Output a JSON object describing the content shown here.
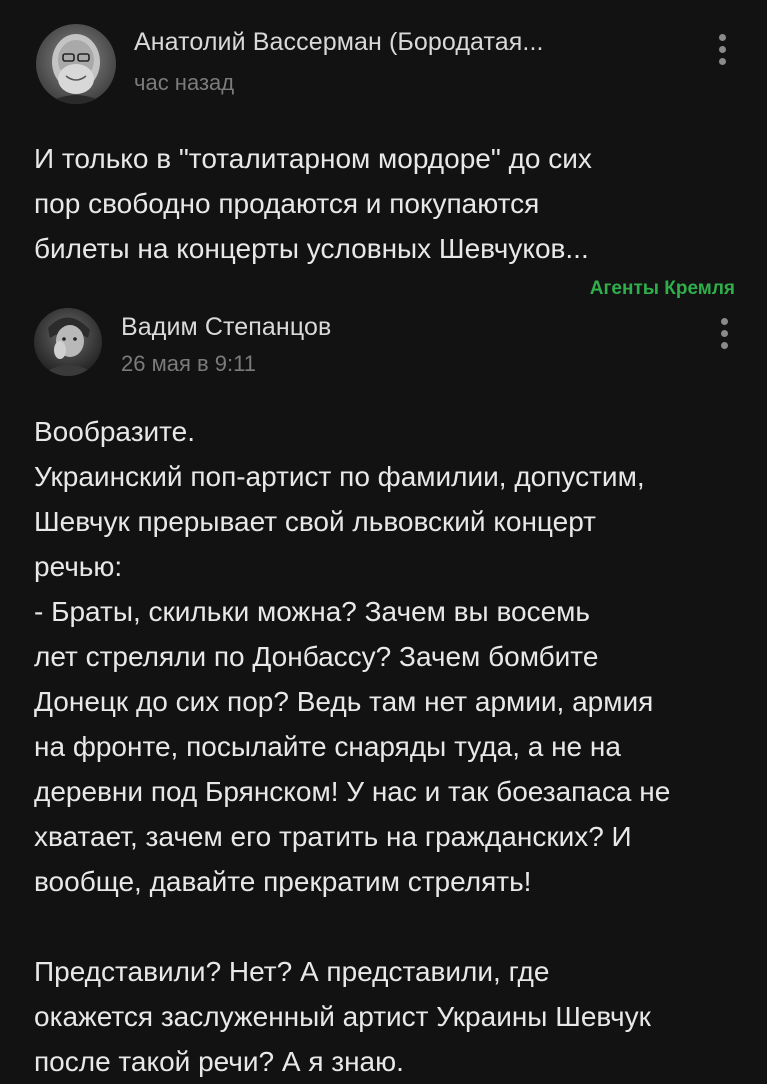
{
  "colors": {
    "background": "#121212",
    "text": "#e8e8e8",
    "muted": "#7b7b7b",
    "tag": "#2fae4b"
  },
  "posts": [
    {
      "author": "Анатолий Вассерман (Бородатая...",
      "time": "час назад",
      "avatar_icon": "user-avatar-icon",
      "menu_icon": "more-vertical-icon",
      "lines": [
        "И только в \"тоталитарном мордоре\" до сих",
        "пор свободно продаются и покупаются",
        "билеты на концерты условных Шевчуков..."
      ]
    },
    {
      "author": "Вадим Степанцов",
      "time": "26 мая в 9:11",
      "avatar_icon": "user-avatar-icon",
      "menu_icon": "more-vertical-icon",
      "lines": [
        "Вообразите.",
        "Украинский поп-артист по фамилии, допустим,",
        "Шевчук прерывает свой львовский концерт",
        "речью:",
        "- Браты, скильки можна? Зачем вы восемь",
        "лет стреляли по Донбассу? Зачем бомбите",
        "Донецк до сих пор? Ведь там нет армии, армия",
        "на фронте, посылайте снаряды туда, а не на",
        "деревни под Брянском! У нас и так боезапаса не",
        "хватает, зачем его тратить на гражданских? И",
        "вообще, давайте прекратим стрелять!",
        "",
        "Представили? Нет? А представили, где",
        "окажется заслуженный артист Украины Шевчук",
        "после такой речи? А я знаю."
      ]
    }
  ],
  "tag": "Агенты Кремля"
}
